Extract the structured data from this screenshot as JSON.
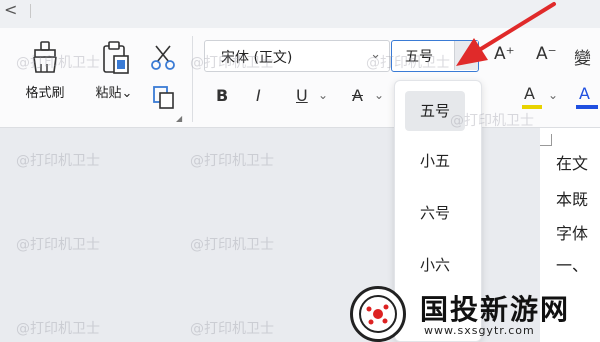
{
  "toolbar": {
    "format_painter_label": "格式刷",
    "paste_label": "粘贴",
    "paste_chevron": "⌄",
    "font_name": "宋体 (正文)",
    "font_name_chevron": "⌄",
    "font_size": "五号",
    "bold": "B",
    "italic": "I",
    "underline": "U",
    "strike": "A",
    "increase_font": "A⁺",
    "decrease_font": "A⁻",
    "phonetic": "變",
    "highlight": "A",
    "font_color": "A",
    "small_chevron": "⌄"
  },
  "font_size_dropdown": {
    "items": [
      "五号",
      "小五",
      "六号",
      "小六"
    ],
    "selected": "五号"
  },
  "document": {
    "lines": [
      "在文",
      "本既",
      "字体",
      "一、"
    ]
  },
  "watermark": "@打印机卫士",
  "logo": {
    "name": "国投新游网",
    "url": "www.sxsgytr.com"
  },
  "colors": {
    "accent": "#3a7bd5",
    "arrow": "#e02a2a",
    "highlight": "#e8d300",
    "font_color": "#1f4fe0"
  },
  "icons": [
    "brush-icon",
    "clipboard-icon",
    "scissors-icon",
    "copy-icon",
    "dialog-launcher-icon"
  ]
}
